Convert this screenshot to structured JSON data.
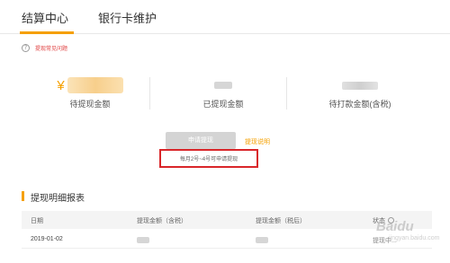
{
  "tabs": [
    {
      "label": "结算中心",
      "active": true
    },
    {
      "label": "银行卡维护",
      "active": false
    }
  ],
  "help": {
    "icon": "question-circle-icon",
    "label": "提现常见问题"
  },
  "stats": [
    {
      "currency_symbol": "¥",
      "label": "待提现金额"
    },
    {
      "label": "已提现金额"
    },
    {
      "label": "待打款金额(含税)"
    }
  ],
  "actions": {
    "apply_label": "申请提现",
    "explain_label": "提现说明",
    "note": "每月2号~4号可申请提现"
  },
  "section": {
    "title": "提现明细报表"
  },
  "table": {
    "columns": [
      "日期",
      "提现金额（含税）",
      "提现金额（税后）",
      "状态"
    ],
    "rows": [
      {
        "date": "2019-01-02",
        "status": "提现中..."
      }
    ]
  },
  "watermark": {
    "brand": "Baidu",
    "sub": "jingyan.baidu.com"
  },
  "colors": {
    "accent": "#f5a000",
    "highlight_box": "#d9262a",
    "help_text": "#e04040"
  }
}
